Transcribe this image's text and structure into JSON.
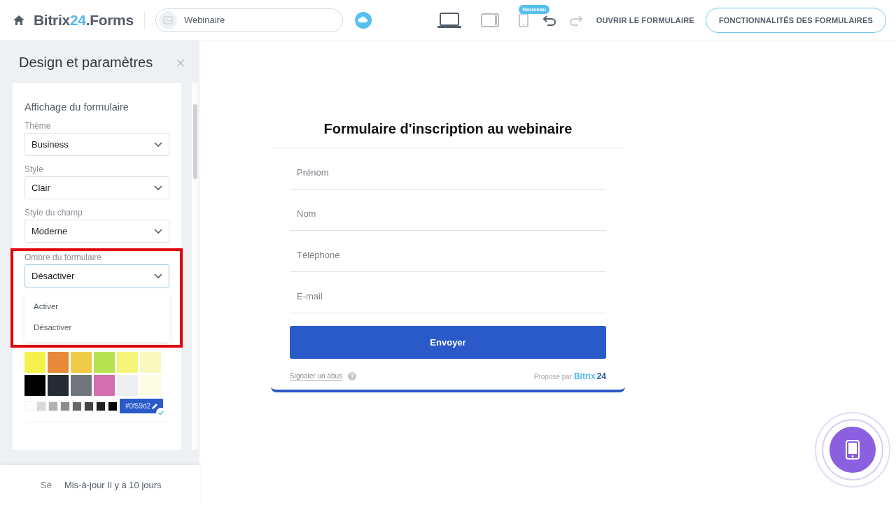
{
  "header": {
    "logo": {
      "name": "Bitrix",
      "accent": "24",
      "suffix": ".Forms"
    },
    "form_name": "Webinaire",
    "devices": [
      {
        "kind": "laptop",
        "selected": true
      },
      {
        "kind": "tablet",
        "selected": false
      },
      {
        "kind": "phone",
        "selected": false,
        "badge": "Nouveau"
      }
    ],
    "undo": {
      "disabled": false
    },
    "redo": {
      "disabled": true
    },
    "open_link": "OUVRIR LE FORMULAIRE",
    "features_button": "FONCTIONNALITÉS DES FORMULAIRES"
  },
  "sidebar": {
    "title": "Design et paramètres",
    "section_title": "Affichage du formulaire",
    "selects": [
      {
        "label": "Thème",
        "value": "Business",
        "open": false
      },
      {
        "label": "Style",
        "value": "Clair",
        "open": false
      },
      {
        "label": "Style du champ",
        "value": "Moderne",
        "open": false
      },
      {
        "label": "Ombre du formulaire",
        "value": "Désactiver",
        "open": true,
        "highlighted": true,
        "options": [
          "Activer",
          "Désactiver"
        ]
      }
    ],
    "swatches": [
      {
        "color": "#f4f04c"
      },
      {
        "color": "#e68a3a"
      },
      {
        "color": "#f0cb48"
      },
      {
        "color": "#b5e24e"
      },
      {
        "color": "#f5f57a"
      },
      {
        "color": "#fafac0"
      },
      {
        "color": "#000000"
      },
      {
        "color": "#252b33"
      },
      {
        "color": "#71767c"
      },
      {
        "color": "#d46eae"
      },
      {
        "color": "#eeeff1"
      },
      {
        "color": "#fdfde3"
      }
    ],
    "small_swatches": [
      {
        "color": "#ffffff"
      },
      {
        "color": "#d9d9d9"
      },
      {
        "color": "#b3b3b3"
      },
      {
        "color": "#8c8c8c"
      },
      {
        "color": "#666666"
      },
      {
        "color": "#444444"
      },
      {
        "color": "#222222"
      },
      {
        "color": "#000000"
      }
    ],
    "custom_color": {
      "value": "#0f59d2",
      "color": "#2a59c9",
      "selected": true
    },
    "footer": {
      "cut_button": "Sé",
      "update_note": "Mis-à-jour Il y a 10 jours"
    }
  },
  "preview": {
    "title": "Formulaire d'inscription au webinaire",
    "fields": [
      {
        "placeholder": "Prénom"
      },
      {
        "placeholder": "Nom"
      },
      {
        "placeholder": "Téléphone"
      },
      {
        "placeholder": "E-mail"
      }
    ],
    "submit": "Envoyer",
    "report_link": "Signaler un abus",
    "powered": {
      "text": "Proposé par",
      "brand": "Bitrix",
      "brand_num": "24"
    }
  }
}
